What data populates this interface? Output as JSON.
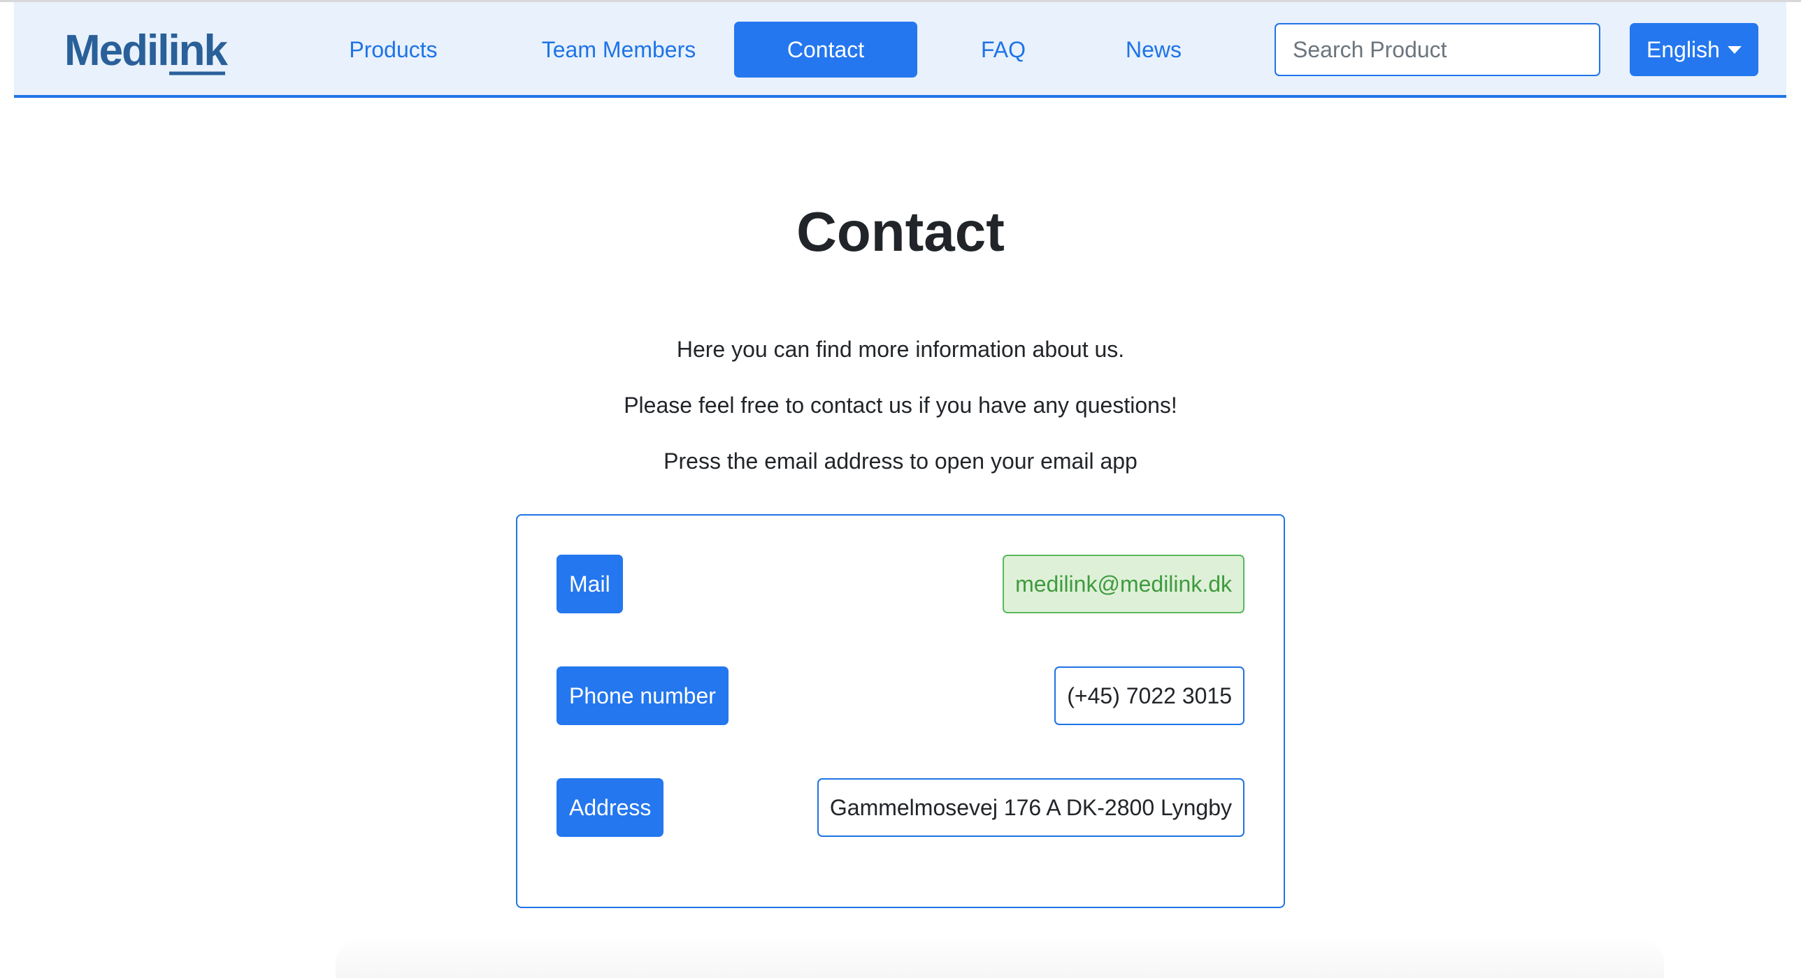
{
  "brand": {
    "logo_text": "Medilink",
    "logo_color": "#2a6099"
  },
  "nav": {
    "items": [
      {
        "label": "Products"
      },
      {
        "label": "Team Members"
      },
      {
        "label": "Contact",
        "active": true
      },
      {
        "label": "FAQ"
      },
      {
        "label": "News"
      }
    ],
    "search_placeholder": "Search Product",
    "language": "English"
  },
  "page": {
    "title": "Contact",
    "intro": [
      "Here you can find more information about us.",
      "Please feel free to contact us if you have any questions!",
      "Press the email address to open your email app"
    ]
  },
  "contact": {
    "mail": {
      "label": "Mail",
      "value": "medilink@medilink.dk"
    },
    "phone": {
      "label": "Phone number",
      "value": "(+45) 7022 3015"
    },
    "address": {
      "label": "Address",
      "value": "Gammelmosevej 176 A DK-2800 Lyngby"
    }
  },
  "colors": {
    "accent": "#2477ee",
    "nav_background": "#e8f1fc",
    "mail_background": "#dff0d8",
    "mail_text": "#3e9b3e"
  }
}
